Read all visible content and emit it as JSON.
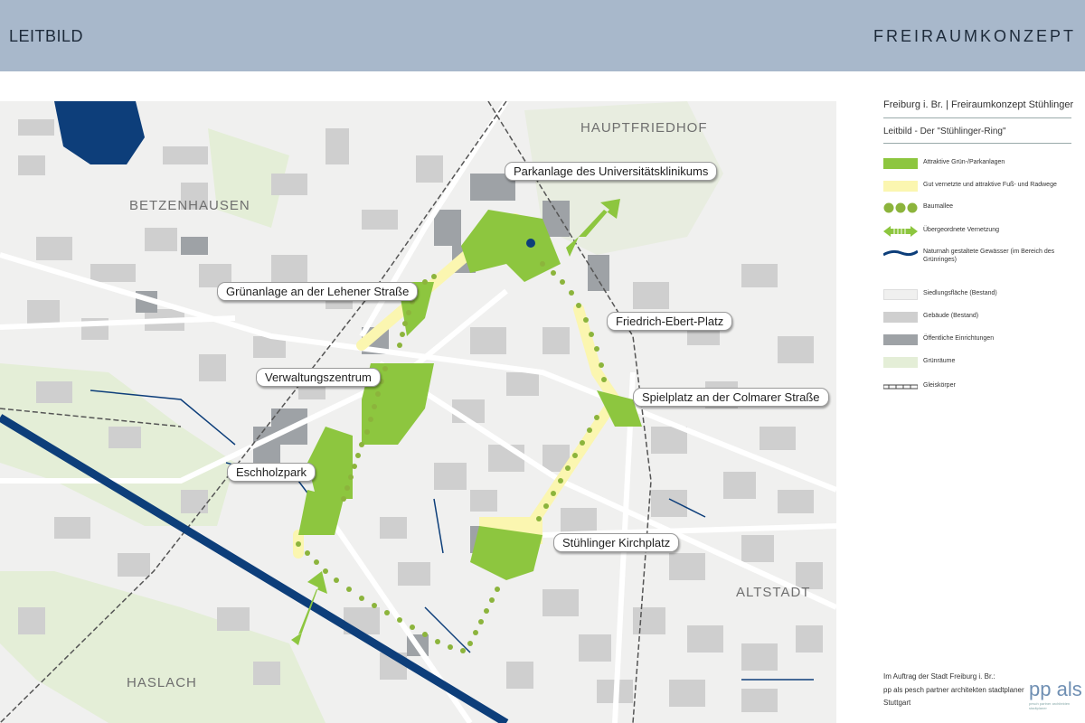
{
  "header": {
    "left_title": "LEITBILD",
    "right_title": "FREIRAUMKONZEPT"
  },
  "map": {
    "districts": [
      "HAUPTFRIEDHOF",
      "BETZENHAUSEN",
      "ALTSTADT",
      "HASLACH"
    ],
    "callouts": [
      "Parkanlage des Universitätsklinikums",
      "Grünanlage an der Lehener Straße",
      "Friedrich-Ebert-Platz",
      "Verwaltungszentrum",
      "Spielplatz an der Colmarer Straße",
      "Eschholzpark",
      "Stühlinger Kirchplatz"
    ],
    "colors": {
      "green_park": "#8dc63f",
      "path_yellow": "#fbf6b0",
      "tree_green": "#8cb43c",
      "water": "#0d3e7a",
      "settlement": "#f0f0ef",
      "building": "#cfcfcf",
      "public_building": "#9ea2a6",
      "green_space": "#e4eed7"
    }
  },
  "legend": {
    "title": "Freiburg i. Br. | Freiraumkonzept Stühlinger",
    "subtitle": "Leitbild - Der \"Stühlinger-Ring\"",
    "items": [
      {
        "label": "Attraktive Grün-/Parkanlagen",
        "icon": "green-park-swatch"
      },
      {
        "label": "Gut vernetzte und attraktive Fuß- und Radwege",
        "icon": "path-swatch"
      },
      {
        "label": "Baumallee",
        "icon": "tree-row-swatch"
      },
      {
        "label": "Übergeordnete Vernetzung",
        "icon": "double-arrow-swatch"
      },
      {
        "label": "Naturnah gestaltete Gewässer (im Bereich des Grünringes)",
        "icon": "water-line-swatch"
      },
      {
        "label": "Siedlungsfläche (Bestand)",
        "icon": "settlement-swatch"
      },
      {
        "label": "Gebäude (Bestand)",
        "icon": "building-swatch"
      },
      {
        "label": "Öffentliche Einrichtungen",
        "icon": "public-building-swatch"
      },
      {
        "label": "Grünräume",
        "icon": "green-space-swatch"
      },
      {
        "label": "Gleiskörper",
        "icon": "rail-swatch"
      }
    ]
  },
  "footer": {
    "line1": "Im Auftrag der Stadt Freiburg i. Br.:",
    "line2": "pp als pesch partner architekten stadtplaner",
    "line3": "Stuttgart",
    "logo": "pp als",
    "logo_sub": "pesch partner architekten stadtplaner"
  }
}
